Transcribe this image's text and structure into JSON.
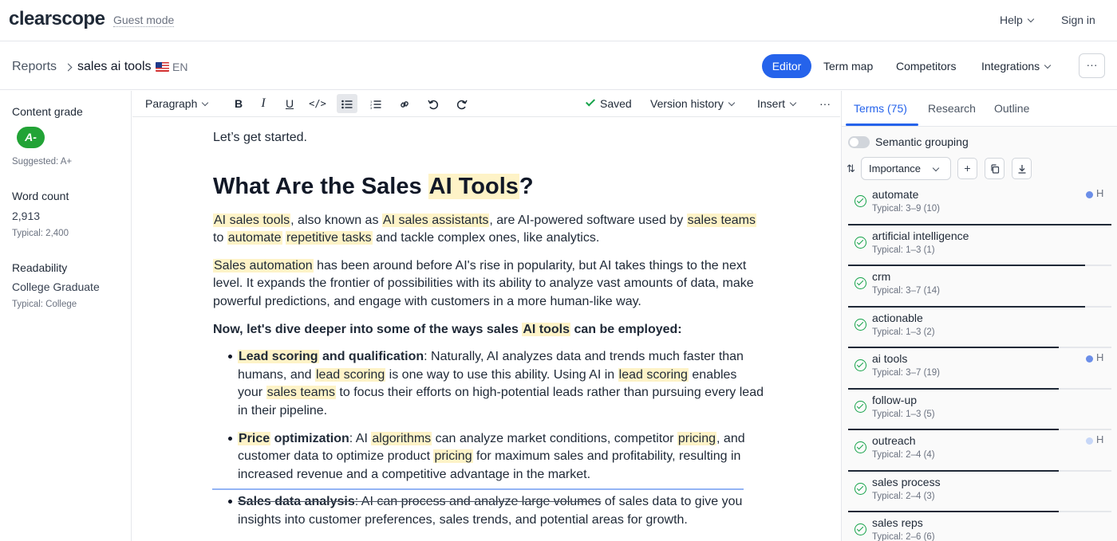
{
  "topbar": {
    "logo": "clearscope",
    "guest_mode": "Guest mode",
    "help": "Help",
    "sign_in": "Sign in"
  },
  "subbar": {
    "breadcrumb_reports": "Reports",
    "report_title": "sales ai tools",
    "language": "EN",
    "editor": "Editor",
    "term_map": "Term map",
    "competitors": "Competitors",
    "integrations": "Integrations",
    "more": "···"
  },
  "left": {
    "content_grade_label": "Content grade",
    "grade": "A-",
    "suggested": "Suggested: A+",
    "word_count_label": "Word count",
    "word_count": "2,913",
    "word_count_typical": "Typical: 2,400",
    "readability_label": "Readability",
    "readability": "College Graduate",
    "readability_typical": "Typical: College"
  },
  "toolbar": {
    "paragraph": "Paragraph",
    "saved": "Saved",
    "version_history": "Version history",
    "insert": "Insert",
    "more": "···"
  },
  "doc": {
    "intro": "Let’s get started.",
    "h1_a": "What Are the Sales ",
    "h1_hl": "AI Tools",
    "h1_b": "?",
    "p1": [
      "AI sales tools",
      ", also known as ",
      "AI sales assistants",
      ", are AI-powered software used by ",
      "sales teams",
      " to ",
      "automate",
      " ",
      "repetitive tasks",
      " and tackle complex ones, like analytics."
    ],
    "p2": [
      "Sales automation",
      " has been around before AI's rise in popularity, but AI takes things to the next level. It expands the frontier of possibilities with its ability to analyze vast amounts of data, make powerful predictions, and engage with customers in a more human-like way."
    ],
    "p3": [
      "Now, let's dive deeper into some of the ways sales ",
      "AI tools",
      " can be employed:"
    ],
    "b1": [
      "Lead scoring",
      " and qualification",
      ": Naturally, AI analyzes data and trends much faster than humans, and ",
      "lead scoring",
      " is one way to use this ability. Using AI in ",
      "lead scoring",
      " enables your ",
      "sales teams",
      " to focus their efforts on high-potential leads rather than pursuing every lead in their pipeline."
    ],
    "b2": [
      "Price",
      " optimization",
      ": AI ",
      "algorithms",
      " can analyze market conditions, competitor ",
      "pricing",
      ", and customer data to optimize product ",
      "pricing",
      " for maximum sales and profitability, resulting in increased revenue and a competitive advantage in the market."
    ],
    "b3": [
      "Sales data analysis",
      ": AI can process and analyze large volumes",
      " of sales data to give you insights into customer preferences, sales trends, and potential areas for growth."
    ]
  },
  "right": {
    "tab_terms": "Terms (75)",
    "tab_research": "Research",
    "tab_outline": "Outline",
    "semantic_grouping": "Semantic grouping",
    "sort": "Importance",
    "terms": [
      {
        "name": "automate",
        "typical": "Typical: 3–9 (10)",
        "priority": "H",
        "fill": 1.0,
        "dot": "strong"
      },
      {
        "name": "artificial intelligence",
        "typical": "Typical: 1–3 (1)",
        "priority": "",
        "fill": 0.9,
        "dot": ""
      },
      {
        "name": "crm",
        "typical": "Typical: 3–7 (14)",
        "priority": "",
        "fill": 0.9,
        "dot": ""
      },
      {
        "name": "actionable",
        "typical": "Typical: 1–3 (2)",
        "priority": "",
        "fill": 0.8,
        "dot": ""
      },
      {
        "name": "ai tools",
        "typical": "Typical: 3–7 (19)",
        "priority": "H",
        "fill": 0.8,
        "dot": "strong"
      },
      {
        "name": "follow-up",
        "typical": "Typical: 1–3 (5)",
        "priority": "",
        "fill": 0.8,
        "dot": ""
      },
      {
        "name": "outreach",
        "typical": "Typical: 2–4 (4)",
        "priority": "H",
        "fill": 0.8,
        "dot": "light"
      },
      {
        "name": "sales process",
        "typical": "Typical: 2–4 (3)",
        "priority": "",
        "fill": 0.8,
        "dot": ""
      },
      {
        "name": "sales reps",
        "typical": "Typical: 2–6 (6)",
        "priority": "",
        "fill": 0.8,
        "dot": ""
      }
    ]
  }
}
